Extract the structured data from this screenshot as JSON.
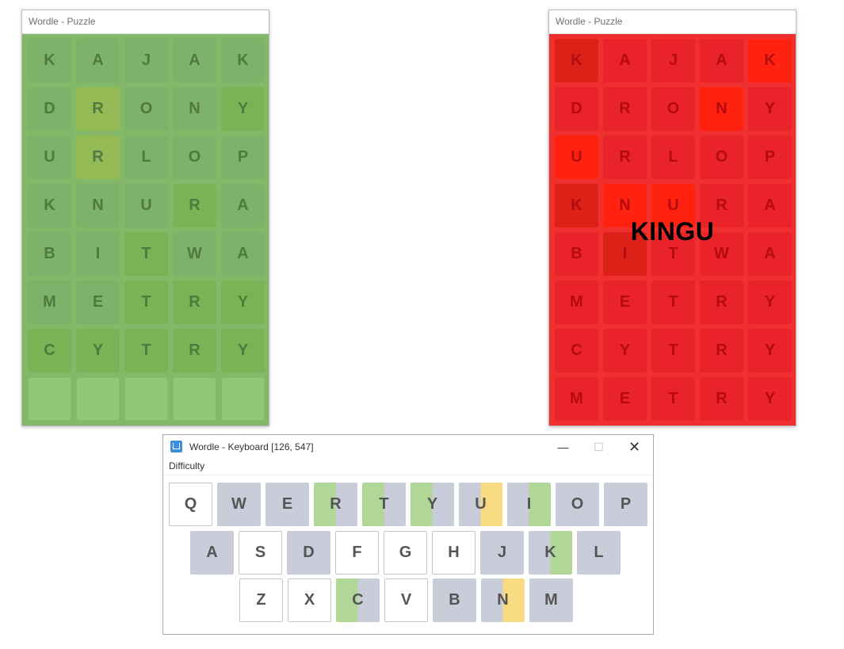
{
  "left_puzzle": {
    "title": "Wordle - Puzzle",
    "rows": [
      [
        "K",
        "A",
        "J",
        "A",
        "K"
      ],
      [
        "D",
        "R",
        "O",
        "N",
        "Y"
      ],
      [
        "U",
        "R",
        "L",
        "O",
        "P"
      ],
      [
        "K",
        "N",
        "U",
        "R",
        "A"
      ],
      [
        "B",
        "I",
        "T",
        "W",
        "A"
      ],
      [
        "M",
        "E",
        "T",
        "R",
        "Y"
      ],
      [
        "C",
        "Y",
        "T",
        "R",
        "Y"
      ],
      [
        "",
        "",
        "",
        "",
        ""
      ]
    ]
  },
  "right_puzzle": {
    "title": "Wordle - Puzzle",
    "overlay_text": "KINGU",
    "rows": [
      [
        "K",
        "A",
        "J",
        "A",
        "K"
      ],
      [
        "D",
        "R",
        "O",
        "N",
        "Y"
      ],
      [
        "U",
        "R",
        "L",
        "O",
        "P"
      ],
      [
        "K",
        "N",
        "U",
        "R",
        "A"
      ],
      [
        "B",
        "I",
        "T",
        "W",
        "A"
      ],
      [
        "M",
        "E",
        "T",
        "R",
        "Y"
      ],
      [
        "C",
        "Y",
        "T",
        "R",
        "Y"
      ],
      [
        "M",
        "E",
        "T",
        "R",
        "Y"
      ]
    ]
  },
  "keyboard_window": {
    "title": "Wordle - Keyboard  [126,  547]",
    "minimize_glyph": "—",
    "maximize_glyph": "☐",
    "close_glyph": "✕",
    "menu": [
      "Difficulty"
    ],
    "rows": [
      [
        "Q",
        "W",
        "E",
        "R",
        "T",
        "Y",
        "U",
        "I",
        "O",
        "P"
      ],
      [
        "A",
        "S",
        "D",
        "F",
        "G",
        "H",
        "J",
        "K",
        "L"
      ],
      [
        "Z",
        "X",
        "C",
        "V",
        "B",
        "N",
        "M"
      ]
    ]
  },
  "colors": {
    "left_board_bg": "#82b868",
    "right_board_bg": "#f0302f",
    "key_gray": "#c8cdd9",
    "key_green": "#b0d698",
    "key_yellow": "#f8da82"
  }
}
